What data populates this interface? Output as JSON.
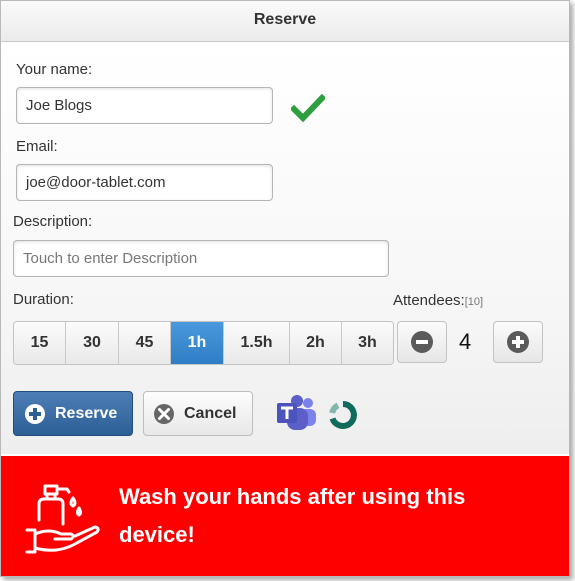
{
  "dialog": {
    "title": "Reserve"
  },
  "form": {
    "name_label": "Your name:",
    "name_value": "Joe Blogs",
    "email_label": "Email:",
    "email_value": "joe@door-tablet.com",
    "description_label": "Description:",
    "description_placeholder": "Touch to enter Description",
    "duration_label": "Duration:",
    "durations": [
      "15",
      "30",
      "45",
      "1h",
      "1.5h",
      "2h",
      "3h"
    ],
    "duration_selected": "1h",
    "attendees_label": "Attendees:",
    "attendees_max": "[10]",
    "attendees_count": "4"
  },
  "actions": {
    "reserve_label": "Reserve",
    "cancel_label": "Cancel"
  },
  "icons": {
    "name_valid": "checkmark-icon",
    "decrement": "minus-circle-icon",
    "increment": "plus-circle-icon",
    "reserve": "plus-circle-icon",
    "cancel": "close-circle-icon",
    "integration_1": "microsoft-teams-icon",
    "integration_2": "ring-logo-icon",
    "banner": "hand-sanitizer-icon"
  },
  "banner": {
    "message": "Wash your hands after using this device!"
  },
  "colors": {
    "accent": "#3182cc",
    "reserve_button": "#3a6ea8",
    "check": "#2e9e3e",
    "banner_bg": "#ff0000",
    "teams": "#5b5fc7",
    "ring": "#0f6b5b"
  }
}
